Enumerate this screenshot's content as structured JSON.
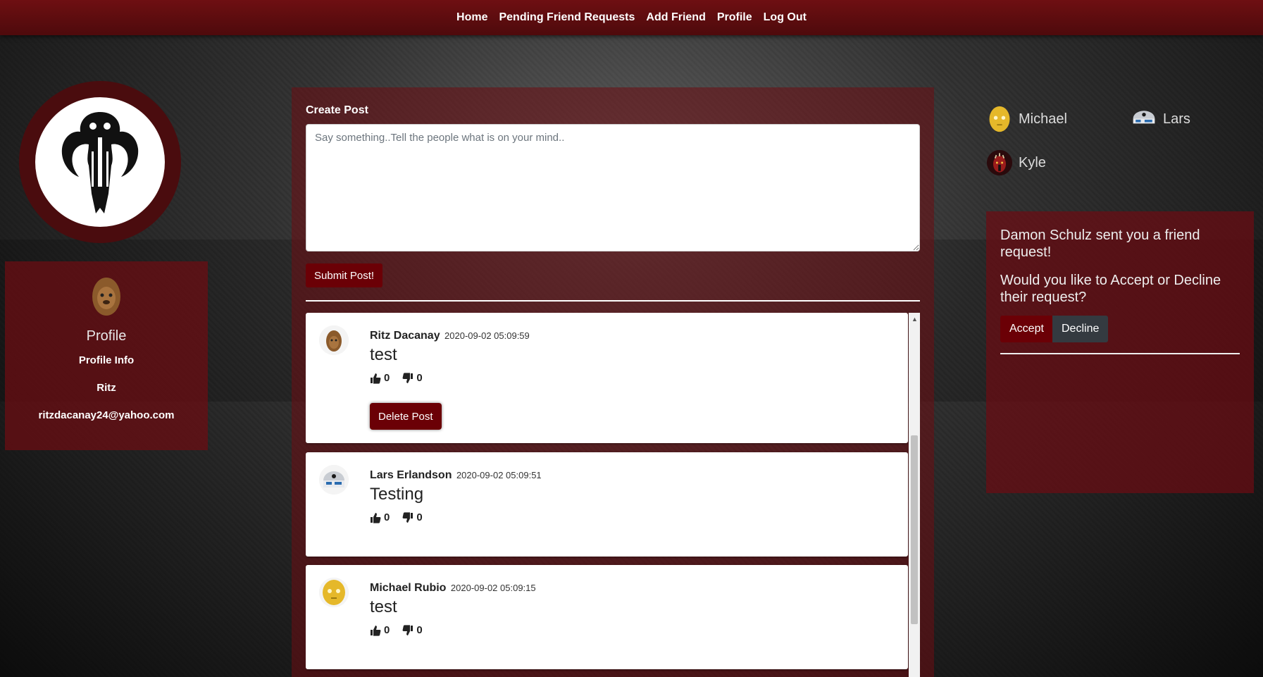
{
  "nav": {
    "items": [
      {
        "label": "Home"
      },
      {
        "label": "Pending Friend Requests"
      },
      {
        "label": "Add Friend"
      },
      {
        "label": "Profile"
      },
      {
        "label": "Log Out"
      }
    ]
  },
  "logo": {
    "icon": "mandalorian-mythosaur-icon"
  },
  "profile_card": {
    "avatar_icon": "chewbacca-avatar",
    "title": "Profile",
    "info_label": "Profile Info",
    "name": "Ritz",
    "email": "ritzdacanay24@yahoo.com"
  },
  "create_post": {
    "label": "Create Post",
    "placeholder": "Say something..Tell the people what is on your mind..",
    "value": "",
    "submit_label": "Submit Post!"
  },
  "posts": [
    {
      "author": "Ritz Dacanay",
      "date": "2020-09-02 05:09:59",
      "body": "test",
      "likes": "0",
      "dislikes": "0",
      "avatar_icon": "chewbacca-avatar",
      "delete_label": "Delete Post"
    },
    {
      "author": "Lars Erlandson",
      "date": "2020-09-02 05:09:51",
      "body": "Testing",
      "likes": "0",
      "dislikes": "0",
      "avatar_icon": "r2d2-avatar"
    },
    {
      "author": "Michael Rubio",
      "date": "2020-09-02 05:09:15",
      "body": "test",
      "likes": "0",
      "dislikes": "0",
      "avatar_icon": "c3po-avatar"
    }
  ],
  "friends": [
    {
      "name": "Michael",
      "avatar_icon": "c3po-avatar"
    },
    {
      "name": "Lars",
      "avatar_icon": "r2d2-avatar"
    },
    {
      "name": "Kyle",
      "avatar_icon": "darth-maul-avatar"
    }
  ],
  "friend_request": {
    "message": "Damon Schulz sent you a friend request!",
    "question": "Would you like to Accept or Decline their request?",
    "accept_label": "Accept",
    "decline_label": "Decline"
  },
  "colors": {
    "nav": "#6e0f12",
    "accent": "#6b0006",
    "panel": "#6e0c12",
    "decline": "#343a40"
  }
}
